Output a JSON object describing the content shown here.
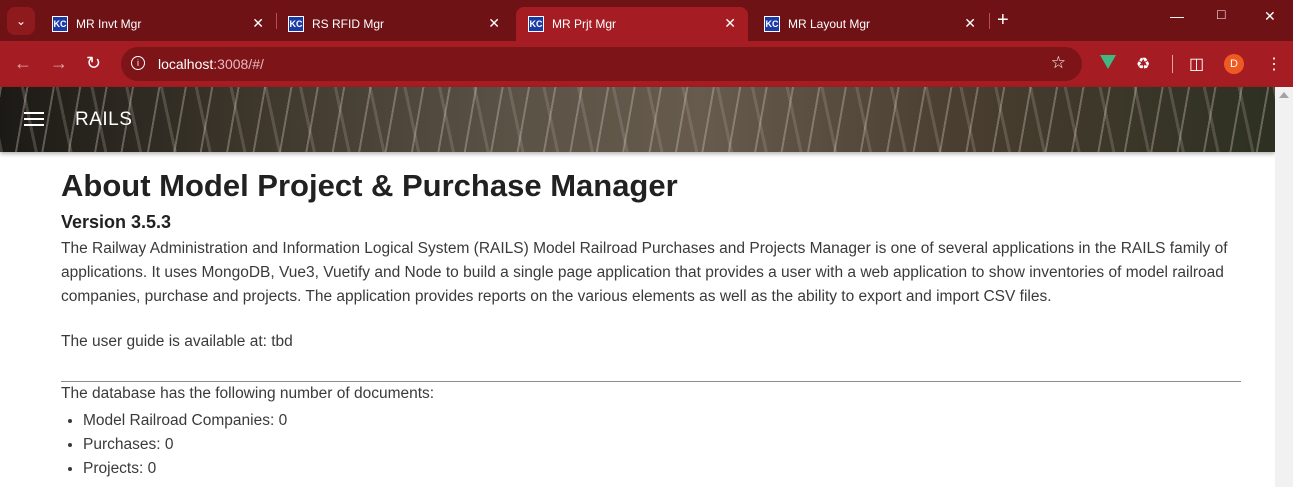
{
  "browser": {
    "tabs": [
      {
        "label": "MR Invt Mgr",
        "active": false
      },
      {
        "label": "RS RFID Mgr",
        "active": false
      },
      {
        "label": "MR Prjt Mgr",
        "active": true
      },
      {
        "label": "MR Layout Mgr",
        "active": false
      }
    ],
    "favicon_text": "KC",
    "url_host": "localhost",
    "url_rest": ":3008/#/",
    "profile_initial": "D",
    "theme_color": "#a51d22"
  },
  "appbar": {
    "title": "RAILS"
  },
  "about": {
    "heading": "About Model Project & Purchase Manager",
    "version": "Version 3.5.3",
    "description": "The Railway Administration and Information Logical System (RAILS) Model Railroad Purchases and Projects Manager is one of several applications in the RAILS family of applications. It uses MongoDB, Vue3, Vuetify and Node to build a single page application that provides a user with a web application to show inventories of model railroad companies, purchase and projects. The application provides reports on the various elements as well as the ability to export and import CSV files.",
    "user_guide": "The user guide is available at: tbd",
    "db_heading": "The database has the following number of documents:",
    "counts": [
      "Model Railroad Companies: 0",
      "Purchases: 0",
      "Projects: 0"
    ]
  }
}
